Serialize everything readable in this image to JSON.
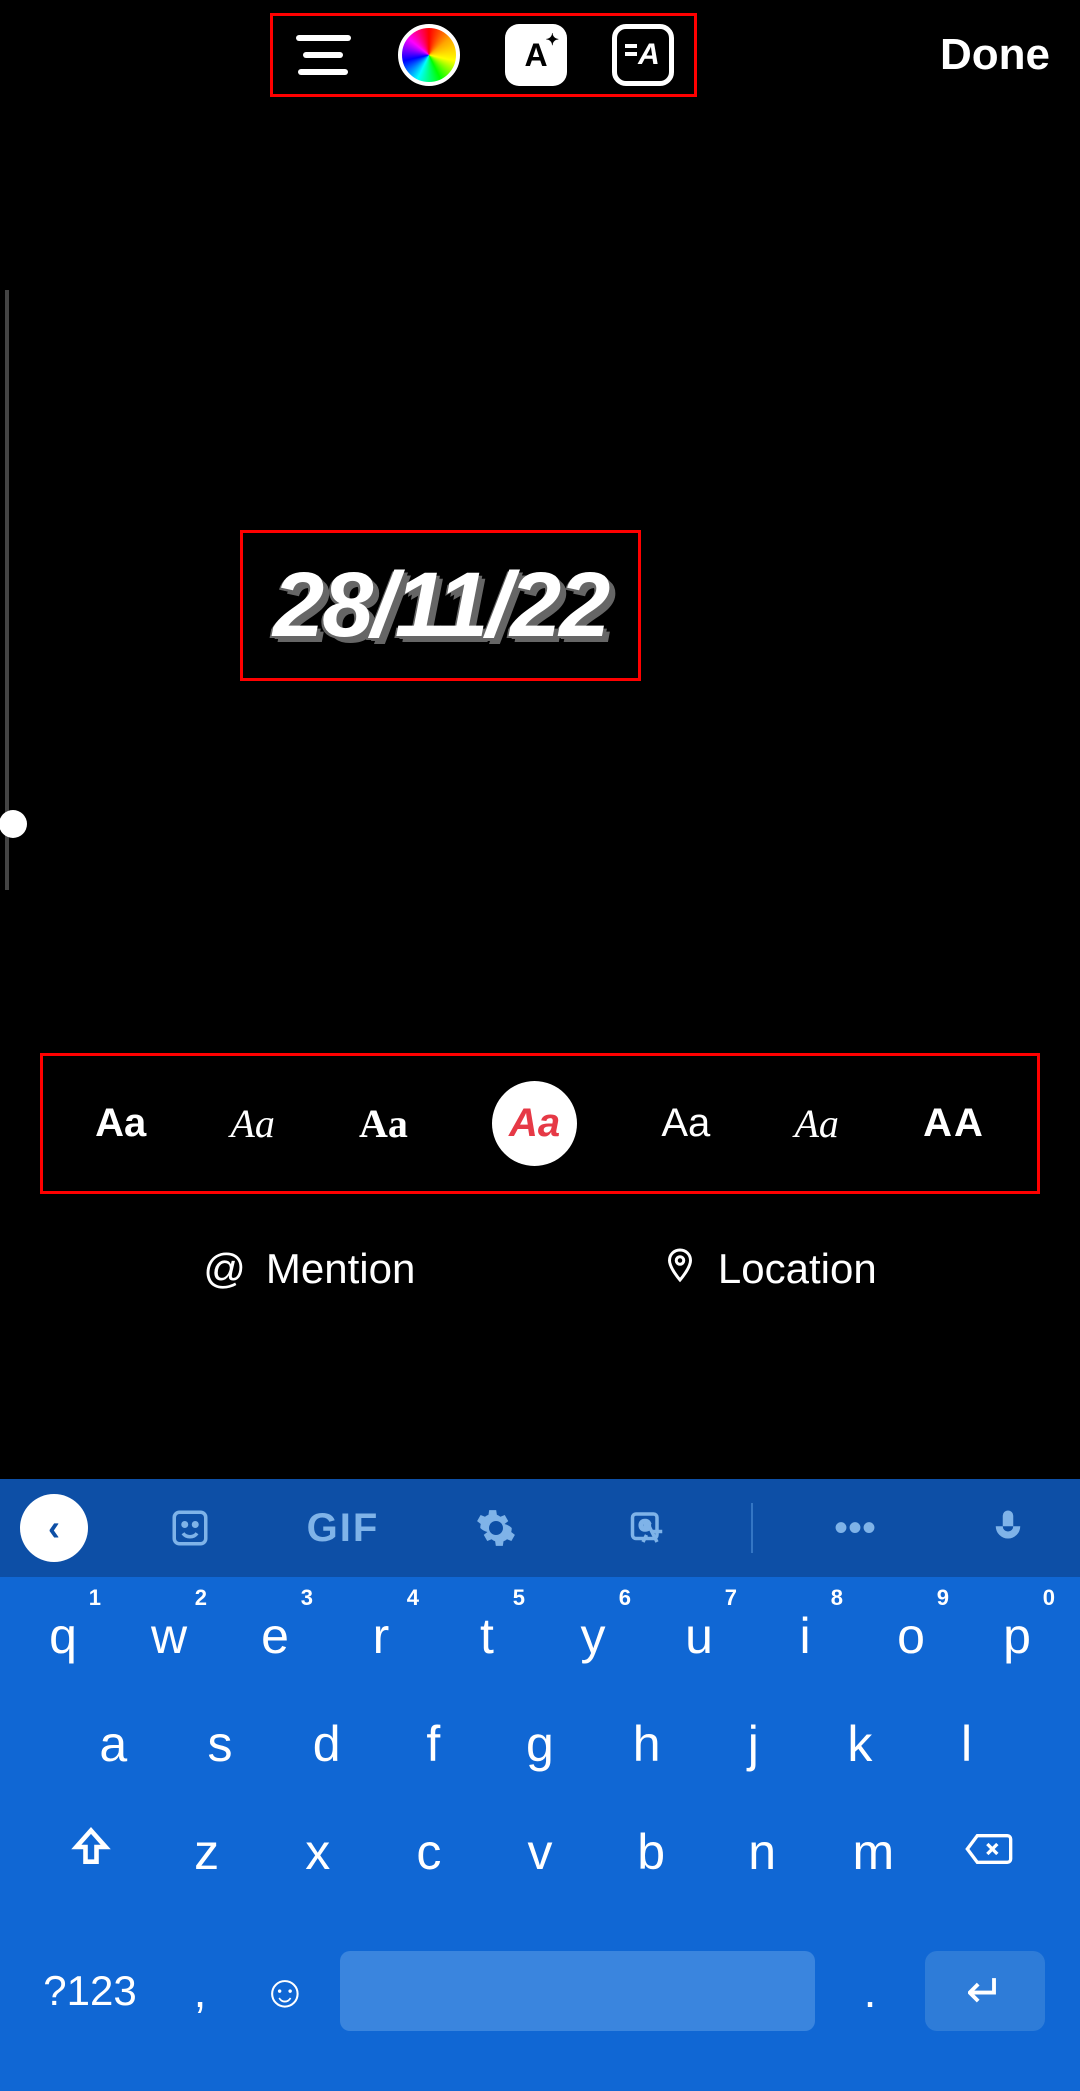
{
  "header": {
    "done_label": "Done"
  },
  "story_text": "28/11/22",
  "font_options": [
    {
      "label": "Aa",
      "style": "bold"
    },
    {
      "label": "Aa",
      "style": "script"
    },
    {
      "label": "Aa",
      "style": "serif"
    },
    {
      "label": "Aa",
      "style": "selected"
    },
    {
      "label": "Aa",
      "style": "light"
    },
    {
      "label": "Aa",
      "style": "italic-serif"
    },
    {
      "label": "AA",
      "style": "caps"
    }
  ],
  "actions": {
    "mention_label": "Mention",
    "location_label": "Location"
  },
  "keyboard": {
    "toolbar": {
      "gif_label": "GIF"
    },
    "row1": [
      {
        "key": "q",
        "hint": "1"
      },
      {
        "key": "w",
        "hint": "2"
      },
      {
        "key": "e",
        "hint": "3"
      },
      {
        "key": "r",
        "hint": "4"
      },
      {
        "key": "t",
        "hint": "5"
      },
      {
        "key": "y",
        "hint": "6"
      },
      {
        "key": "u",
        "hint": "7"
      },
      {
        "key": "i",
        "hint": "8"
      },
      {
        "key": "o",
        "hint": "9"
      },
      {
        "key": "p",
        "hint": "0"
      }
    ],
    "row2": [
      "a",
      "s",
      "d",
      "f",
      "g",
      "h",
      "j",
      "k",
      "l"
    ],
    "row3": [
      "z",
      "x",
      "c",
      "v",
      "b",
      "n",
      "m"
    ],
    "switch_label": "?123",
    "comma": ",",
    "period": "."
  }
}
